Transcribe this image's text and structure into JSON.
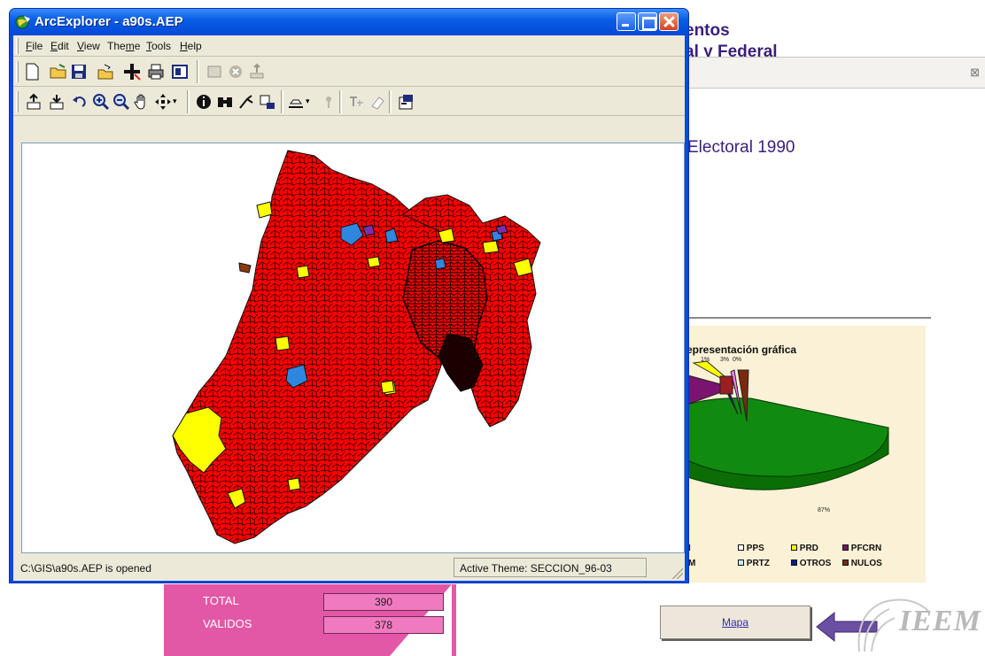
{
  "window": {
    "title": "ArcExplorer - a90s.AEP",
    "menu": [
      "File",
      "Edit",
      "View",
      "Theme",
      "Tools",
      "Help"
    ],
    "menu_accels": [
      "F",
      "E",
      "V",
      "m",
      "T",
      "H"
    ],
    "toolbar1": [
      "new-document-icon",
      "open-folder-icon",
      "save-icon",
      "open-project-icon",
      "add-theme-icon",
      "print-icon",
      "layout-icon",
      "copy-icon",
      "stop-icon",
      "export-icon"
    ],
    "toolbar2": [
      "theme-up-icon",
      "theme-down-icon",
      "undo-icon",
      "zoom-in-icon",
      "zoom-out-icon",
      "pan-icon",
      "full-extent-icon",
      "identify-icon",
      "find-icon",
      "query-icon",
      "select-icon",
      "measure-icon",
      "point-icon",
      "label-icon",
      "erase-icon",
      "properties-icon"
    ],
    "status_left": "C:\\GIS\\a90s.AEP is opened",
    "status_right": "Active Theme: SECCION_96-03",
    "map_colors": {
      "base": "#ff0000",
      "pri": "#ffff00",
      "pan": "#2e86de",
      "prd": "#ffff00",
      "other": "#7a2fb3",
      "border": "#111111"
    }
  },
  "background": {
    "title_line1": "entos",
    "title_line2": "al y Federal",
    "heading": "Electoral 1990",
    "chart": {
      "title": "epresentación gráfica",
      "top_labels": [
        "1%",
        "3%",
        "0%"
      ],
      "big_label": "87%",
      "legend_row1": [
        "I",
        "PPS",
        "PRD",
        "PFCRN"
      ],
      "legend_row2": [
        "M",
        "PRTZ",
        "OTROS",
        "NULOS"
      ],
      "legend_colors_row1": [
        "#ffffff",
        "#ffffff",
        "#ffff00",
        "#7a1470"
      ],
      "legend_colors_row2": [
        "#ffffff",
        "#c9e7ff",
        "#0e1a8c",
        "#7a2a10"
      ]
    },
    "table": {
      "rows": [
        {
          "label": "TOTAL",
          "value": "390"
        },
        {
          "label": "VALIDOS",
          "value": "378"
        }
      ]
    },
    "mapa_button": "Mapa",
    "logo_text": "IEEM"
  },
  "chart_data": {
    "type": "pie",
    "title": "epresentación gráfica",
    "categories": [
      "I",
      "PPS",
      "PRD",
      "PFCRN",
      "M",
      "PRTZ",
      "OTROS",
      "NULOS"
    ],
    "values_labels_visible": [
      "1%",
      "3%",
      "0%",
      "87%"
    ]
  }
}
